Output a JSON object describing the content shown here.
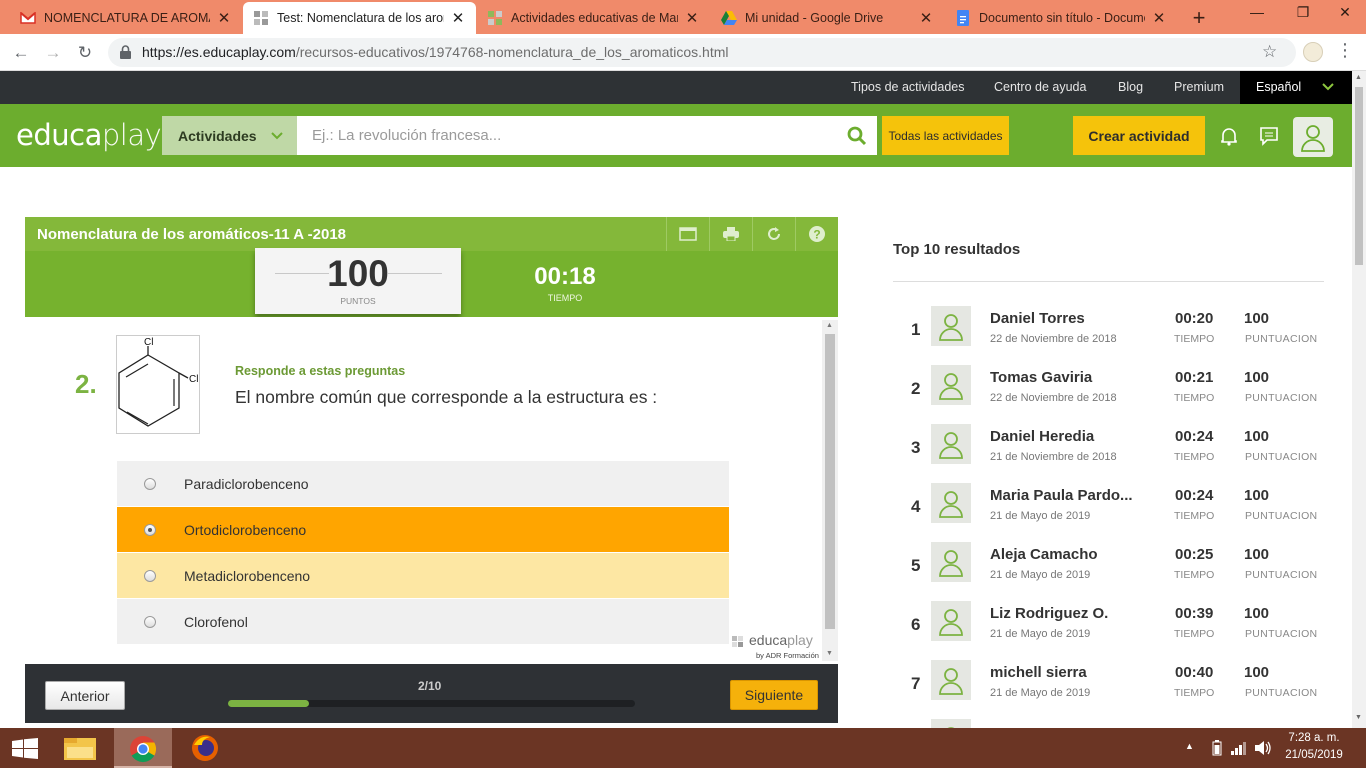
{
  "browser": {
    "tabs": [
      {
        "title": "NOMENCLATURA DE AROMATIC",
        "icon": "gmail-icon"
      },
      {
        "title": "Test: Nomenclatura de los arom",
        "icon": "educaplay-tab-icon"
      },
      {
        "title": "Actividades educativas de Maria",
        "icon": "educaplay-tab-icon"
      },
      {
        "title": "Mi unidad - Google Drive",
        "icon": "google-drive-icon"
      },
      {
        "title": "Documento sin título - Docume",
        "icon": "google-docs-icon"
      }
    ],
    "url_host": "https://es.educaplay.com",
    "url_path": "/recursos-educativos/1974768-nomenclatura_de_los_aromaticos.html"
  },
  "topnav": {
    "links": [
      "Tipos de actividades",
      "Centro de ayuda",
      "Blog",
      "Premium"
    ],
    "language": "Español"
  },
  "header": {
    "logo_a": "educa",
    "logo_b": "play",
    "activities_select": "Actividades",
    "search_placeholder": "Ej.: La revolución francesa...",
    "all_activities": "Todas las actividades",
    "create_button": "Crear actividad"
  },
  "quiz": {
    "title": "Nomenclatura de los aromáticos-11 A -2018",
    "score": "100",
    "score_label": "PUNTOS",
    "time": "00:18",
    "time_label": "TIEMPO",
    "question_number": "2.",
    "instruction": "Responde a estas preguntas",
    "question": "El nombre común que corresponde a la estructura es :",
    "molecule_labels": [
      "Cl",
      "Cl"
    ],
    "options": [
      {
        "label": "Paradiclorobenceno",
        "state": "default",
        "selected": false
      },
      {
        "label": "Ortodiclorobenceno",
        "state": "selected",
        "selected": true
      },
      {
        "label": "Metadiclorobenceno",
        "state": "hover",
        "selected": false
      },
      {
        "label": "Clorofenol",
        "state": "default",
        "selected": false
      }
    ],
    "watermark_a": "educa",
    "watermark_b": "play",
    "watermark_sub": "by ADR Formación",
    "prev_button": "Anterior",
    "next_button": "Siguiente",
    "progress_text": "2/10",
    "progress_fraction": 0.2
  },
  "ranking": {
    "title": "Top 10 resultados",
    "time_label": "TIEMPO",
    "points_label": "PUNTUACION",
    "rows": [
      {
        "rank": "1",
        "name": "Daniel Torres",
        "date": "22 de Noviembre de 2018",
        "time": "00:20",
        "points": "100"
      },
      {
        "rank": "2",
        "name": "Tomas Gaviria",
        "date": "22 de Noviembre de 2018",
        "time": "00:21",
        "points": "100"
      },
      {
        "rank": "3",
        "name": "Daniel Heredia",
        "date": "21 de Noviembre de 2018",
        "time": "00:24",
        "points": "100"
      },
      {
        "rank": "4",
        "name": "Maria Paula Pardo...",
        "date": "21 de Mayo de 2019",
        "time": "00:24",
        "points": "100"
      },
      {
        "rank": "5",
        "name": "Aleja Camacho",
        "date": "21 de Mayo de 2019",
        "time": "00:25",
        "points": "100"
      },
      {
        "rank": "6",
        "name": "Liz Rodriguez O.",
        "date": "21 de Mayo de 2019",
        "time": "00:39",
        "points": "100"
      },
      {
        "rank": "7",
        "name": "michell sierra",
        "date": "21 de Mayo de 2019",
        "time": "00:40",
        "points": "100"
      }
    ]
  },
  "taskbar": {
    "time": "7:28 a. m.",
    "date": "21/05/2019"
  },
  "colors": {
    "brand_green": "#6cad2e",
    "quiz_green": "#84b83a",
    "accent_yellow": "#f5c30b",
    "selected_orange": "#ffa500",
    "hover_yellow": "#fde7a3",
    "tab_strip": "#f08a6a"
  }
}
